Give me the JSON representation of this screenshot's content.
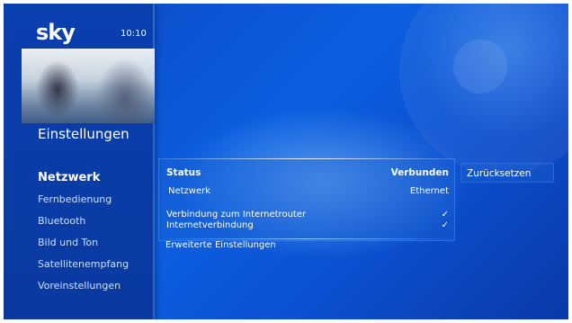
{
  "header": {
    "logo": "sky",
    "time": "10:10"
  },
  "sidebar": {
    "title": "Einstellungen",
    "items": [
      {
        "label": "Netzwerk",
        "active": true
      },
      {
        "label": "Fernbedienung"
      },
      {
        "label": "Bluetooth"
      },
      {
        "label": "Bild und Ton"
      },
      {
        "label": "Satellitenempfang"
      },
      {
        "label": "Voreinstellungen"
      }
    ]
  },
  "status": {
    "title": "Status",
    "value": "Verbunden",
    "network_label": "Netzwerk",
    "network_value": "Ethernet",
    "router_label": "Verbindung zum Internetrouter",
    "router_check": "✓",
    "internet_label": "Internetverbindung",
    "internet_check": "✓"
  },
  "advanced_label": "Erweiterte Einstellungen",
  "reset_label": "Zurücksetzen",
  "colors": {
    "background": "#0b52d4",
    "sidebar": "#0a3aa6"
  }
}
